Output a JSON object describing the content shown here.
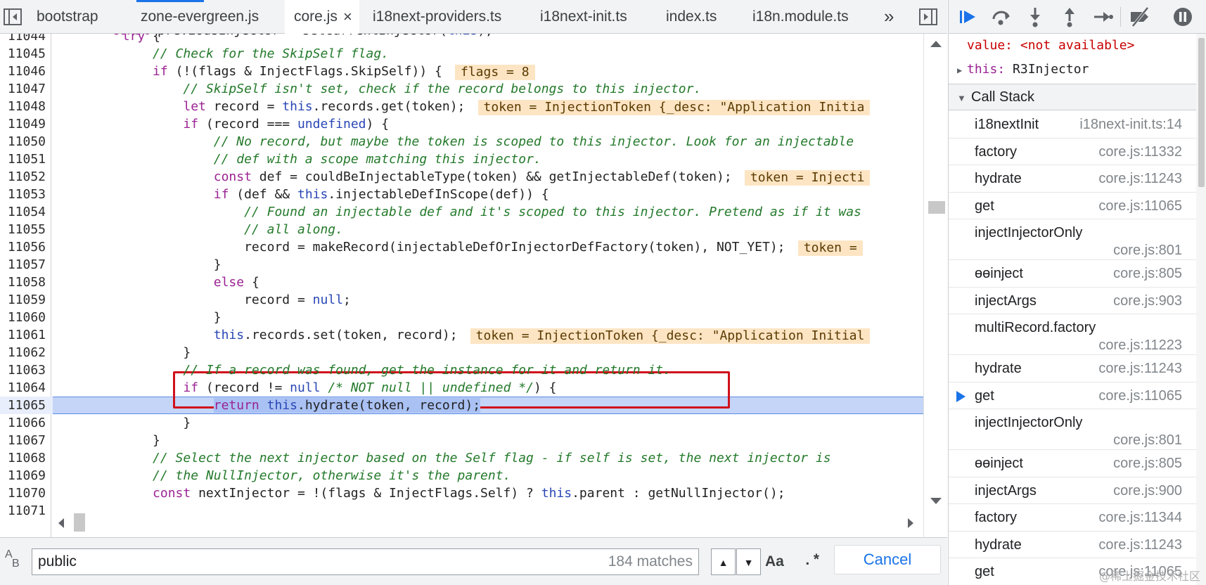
{
  "tabs": [
    {
      "label": "bootstrap"
    },
    {
      "label": "zone-evergreen.js"
    },
    {
      "label": "core.js",
      "active": true
    },
    {
      "label": "i18next-providers.ts"
    },
    {
      "label": "i18next-init.ts"
    },
    {
      "label": "index.ts"
    },
    {
      "label": "i18n.module.ts"
    }
  ],
  "tab_close_glyph": "×",
  "tabs_overflow_glyph": "»",
  "code": {
    "first_partial": "const previousInjector = setCurrentInjector(this);",
    "lines": [
      {
        "n": "11044",
        "text": "        try {"
      },
      {
        "n": "11045",
        "text": "            // Check for the SkipSelf flag."
      },
      {
        "n": "11046",
        "text": "            if (!(flags & InjectFlags.SkipSelf)) {",
        "inline": "flags = 8"
      },
      {
        "n": "11047",
        "text": "                // SkipSelf isn't set, check if the record belongs to this injector."
      },
      {
        "n": "11048",
        "text": "                let record = this.records.get(token);",
        "inline": "token = InjectionToken {_desc: \"Application Initia"
      },
      {
        "n": "11049",
        "text": "                if (record === undefined) {"
      },
      {
        "n": "11050",
        "text": "                    // No record, but maybe the token is scoped to this injector. Look for an injectable"
      },
      {
        "n": "11051",
        "text": "                    // def with a scope matching this injector."
      },
      {
        "n": "11052",
        "text": "                    const def = couldBeInjectableType(token) && getInjectableDef(token);",
        "inline": "token = Injecti"
      },
      {
        "n": "11053",
        "text": "                    if (def && this.injectableDefInScope(def)) {"
      },
      {
        "n": "11054",
        "text": "                        // Found an injectable def and it's scoped to this injector. Pretend as if it was"
      },
      {
        "n": "11055",
        "text": "                        // all along."
      },
      {
        "n": "11056",
        "text": "                        record = makeRecord(injectableDefOrInjectorDefFactory(token), NOT_YET);",
        "inline": "token ="
      },
      {
        "n": "11057",
        "text": "                    }"
      },
      {
        "n": "11058",
        "text": "                    else {"
      },
      {
        "n": "11059",
        "text": "                        record = null;"
      },
      {
        "n": "11060",
        "text": "                    }"
      },
      {
        "n": "11061",
        "text": "                    this.records.set(token, record);",
        "inline": "token = InjectionToken {_desc: \"Application Initial"
      },
      {
        "n": "11062",
        "text": "                }"
      },
      {
        "n": "11063",
        "text": "                // If a record was found, get the instance for it and return it."
      },
      {
        "n": "11064",
        "text": "                if (record != null /* NOT null || undefined */) {"
      },
      {
        "n": "11065",
        "text": "                    return this.hydrate(token, record);",
        "current": true
      },
      {
        "n": "11066",
        "text": "                }"
      },
      {
        "n": "11067",
        "text": "            }"
      },
      {
        "n": "11068",
        "text": "            // Select the next injector based on the Self flag - if self is set, the next injector is"
      },
      {
        "n": "11069",
        "text": "            // the NullInjector, otherwise it's the parent."
      },
      {
        "n": "11070",
        "text": "            const nextInjector = !(flags & InjectFlags.Self) ? this.parent : getNullInjector();"
      },
      {
        "n": "11071",
        "text": ""
      }
    ]
  },
  "search": {
    "value": "public",
    "match_count": "184 matches",
    "prev_glyph": "▲",
    "next_glyph": "▼",
    "match_case_label": "Aa",
    "regex_label": ".*",
    "cancel_label": "Cancel",
    "case_icon_top": "A",
    "case_icon_bottom": "B"
  },
  "scope": {
    "value_key": "value:",
    "value_val": "<not available>",
    "this_key": "this:",
    "this_val": "R3Injector"
  },
  "call_stack": {
    "title": "Call Stack",
    "frames": [
      {
        "name": "i18nextInit",
        "location": "i18next-init.ts:14",
        "layout": "single"
      },
      {
        "name": "factory",
        "location": "core.js:11332",
        "layout": "single"
      },
      {
        "name": "hydrate",
        "location": "core.js:11243",
        "layout": "single"
      },
      {
        "name": "get",
        "location": "core.js:11065",
        "layout": "single"
      },
      {
        "name": "injectInjectorOnly",
        "location": "core.js:801",
        "layout": "double"
      },
      {
        "name": "ɵɵinject",
        "location": "core.js:805",
        "layout": "single"
      },
      {
        "name": "injectArgs",
        "location": "core.js:903",
        "layout": "single"
      },
      {
        "name": "multiRecord.factory",
        "location": "core.js:11223",
        "layout": "double"
      },
      {
        "name": "hydrate",
        "location": "core.js:11243",
        "layout": "single"
      },
      {
        "name": "get",
        "location": "core.js:11065",
        "layout": "single",
        "current": true
      },
      {
        "name": "injectInjectorOnly",
        "location": "core.js:801",
        "layout": "double"
      },
      {
        "name": "ɵɵinject",
        "location": "core.js:805",
        "layout": "single"
      },
      {
        "name": "injectArgs",
        "location": "core.js:900",
        "layout": "single"
      },
      {
        "name": "factory",
        "location": "core.js:11344",
        "layout": "single"
      },
      {
        "name": "hydrate",
        "location": "core.js:11243",
        "layout": "single"
      },
      {
        "name": "get",
        "location": "core.js:11065",
        "layout": "single"
      }
    ]
  },
  "watermark": "@稀土掘金技术社区",
  "colors": {
    "accent": "#1a73e8",
    "highlight_box": "#d0101b",
    "inline_value_bg": "#fde5c4",
    "current_line": "#c4d5f7"
  },
  "icons": {
    "navigator_toggle": "sidebar-left-icon",
    "debugger_toggle": "sidebar-right-icon",
    "resume": "resume-icon",
    "step_over": "step-over-icon",
    "step_into": "step-into-icon",
    "step_out": "step-out-icon",
    "step": "step-icon",
    "deactivate_breakpoints": "deactivate-breakpoints-icon",
    "pause_on_exceptions": "pause-on-exceptions-icon"
  }
}
